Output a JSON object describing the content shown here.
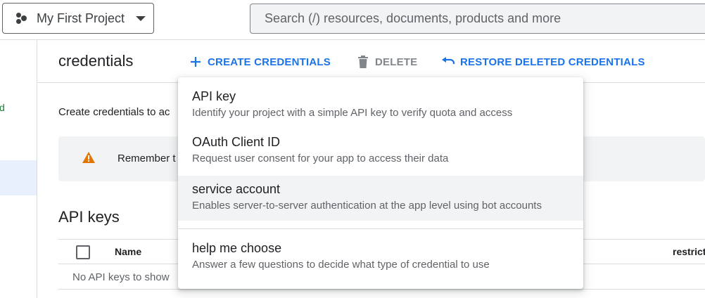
{
  "topbar": {
    "project_name": "My First Project",
    "search_placeholder": "Search (/) resources, documents, products and more"
  },
  "leftrail": {
    "partial_text": "d"
  },
  "header": {
    "title": "credentials",
    "actions": {
      "create": "CREATE CREDENTIALS",
      "delete": "DELETE",
      "restore": "RESTORE DELETED CREDENTIALS"
    }
  },
  "content": {
    "intro": "Create credentials to ac",
    "warning": "Remember t",
    "api_keys_title": "API keys",
    "table": {
      "columns": [
        "Name",
        "restrict"
      ],
      "empty": "No API keys to show"
    }
  },
  "menu": {
    "items": [
      {
        "title": "API key",
        "subtitle": "Identify your project with a simple API key to verify quota and access"
      },
      {
        "title": "OAuth Client ID",
        "subtitle": "Request user consent for your app to access their data"
      },
      {
        "title": "service account",
        "subtitle": "Enables server-to-server authentication at the app level using bot accounts"
      },
      {
        "title": "help me choose",
        "subtitle": "Answer a few questions to decide what type of credential to use"
      }
    ]
  },
  "colors": {
    "accent": "#1a73e8",
    "warning": "#e37400",
    "disabled": "#80868b"
  }
}
